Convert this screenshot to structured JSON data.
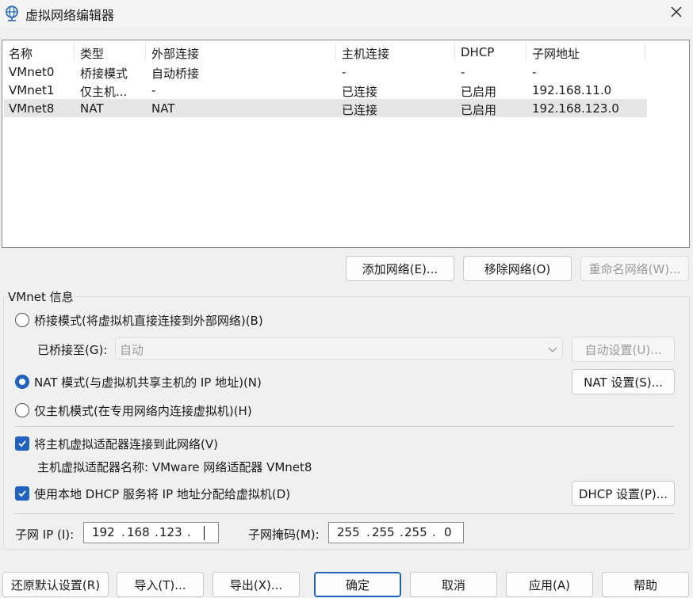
{
  "window": {
    "title": "虚拟网络编辑器",
    "icon": "network-globe-icon",
    "close_icon": "close-icon"
  },
  "network_table": {
    "columns": [
      "名称",
      "类型",
      "外部连接",
      "主机连接",
      "DHCP",
      "子网地址"
    ],
    "rows": [
      [
        "VMnet0",
        "桥接模式",
        "自动桥接",
        "-",
        "-",
        "-"
      ],
      [
        "VMnet1",
        "仅主机...",
        "-",
        "已连接",
        "已启用",
        "192.168.11.0"
      ],
      [
        "VMnet8",
        "NAT",
        "NAT",
        "已连接",
        "已启用",
        "192.168.123.0"
      ]
    ],
    "selected_row": 2
  },
  "list_buttons": {
    "add": "添加网络(E)...",
    "remove": "移除网络(O)",
    "rename": "重命名网络(W)..."
  },
  "vmnet_info": {
    "group_title": "VMnet 信息",
    "bridged_radio": "桥接模式(将虚拟机直接连接到外部网络)(B)",
    "bridged_to_label": "已桥接至(G):",
    "bridged_to_value": "自动",
    "auto_settings_button": "自动设置(U)...",
    "nat_radio": "NAT 模式(与虚拟机共享主机的 IP 地址)(N)",
    "nat_settings_button": "NAT 设置(S)...",
    "hostonly_radio": "仅主机模式(在专用网络内连接虚拟机)(H)",
    "selected_mode": "nat",
    "connect_adapter_checkbox": "将主机虚拟适配器连接到此网络(V)",
    "connect_adapter_checked": true,
    "adapter_name_text": "主机虚拟适配器名称: VMware 网络适配器 VMnet8",
    "dhcp_checkbox": "使用本地 DHCP 服务将 IP 地址分配给虚拟机(D)",
    "dhcp_checked": true,
    "dhcp_settings_button": "DHCP 设置(P)...",
    "subnet_ip_label": "子网 IP (I):",
    "subnet_ip": [
      "192",
      "168",
      "123",
      ""
    ],
    "subnet_mask_label": "子网掩码(M):",
    "subnet_mask": [
      "255",
      "255",
      "255",
      "0"
    ]
  },
  "footer_buttons": {
    "restore": "还原默认设置(R)",
    "import": "导入(T)...",
    "export": "导出(X)...",
    "ok": "确定",
    "cancel": "取消",
    "apply": "应用(A)",
    "help": "帮助"
  },
  "colors": {
    "accent": "#1f62bf",
    "background": "#f0f0f0",
    "selected_row": "#e6e6e6"
  }
}
